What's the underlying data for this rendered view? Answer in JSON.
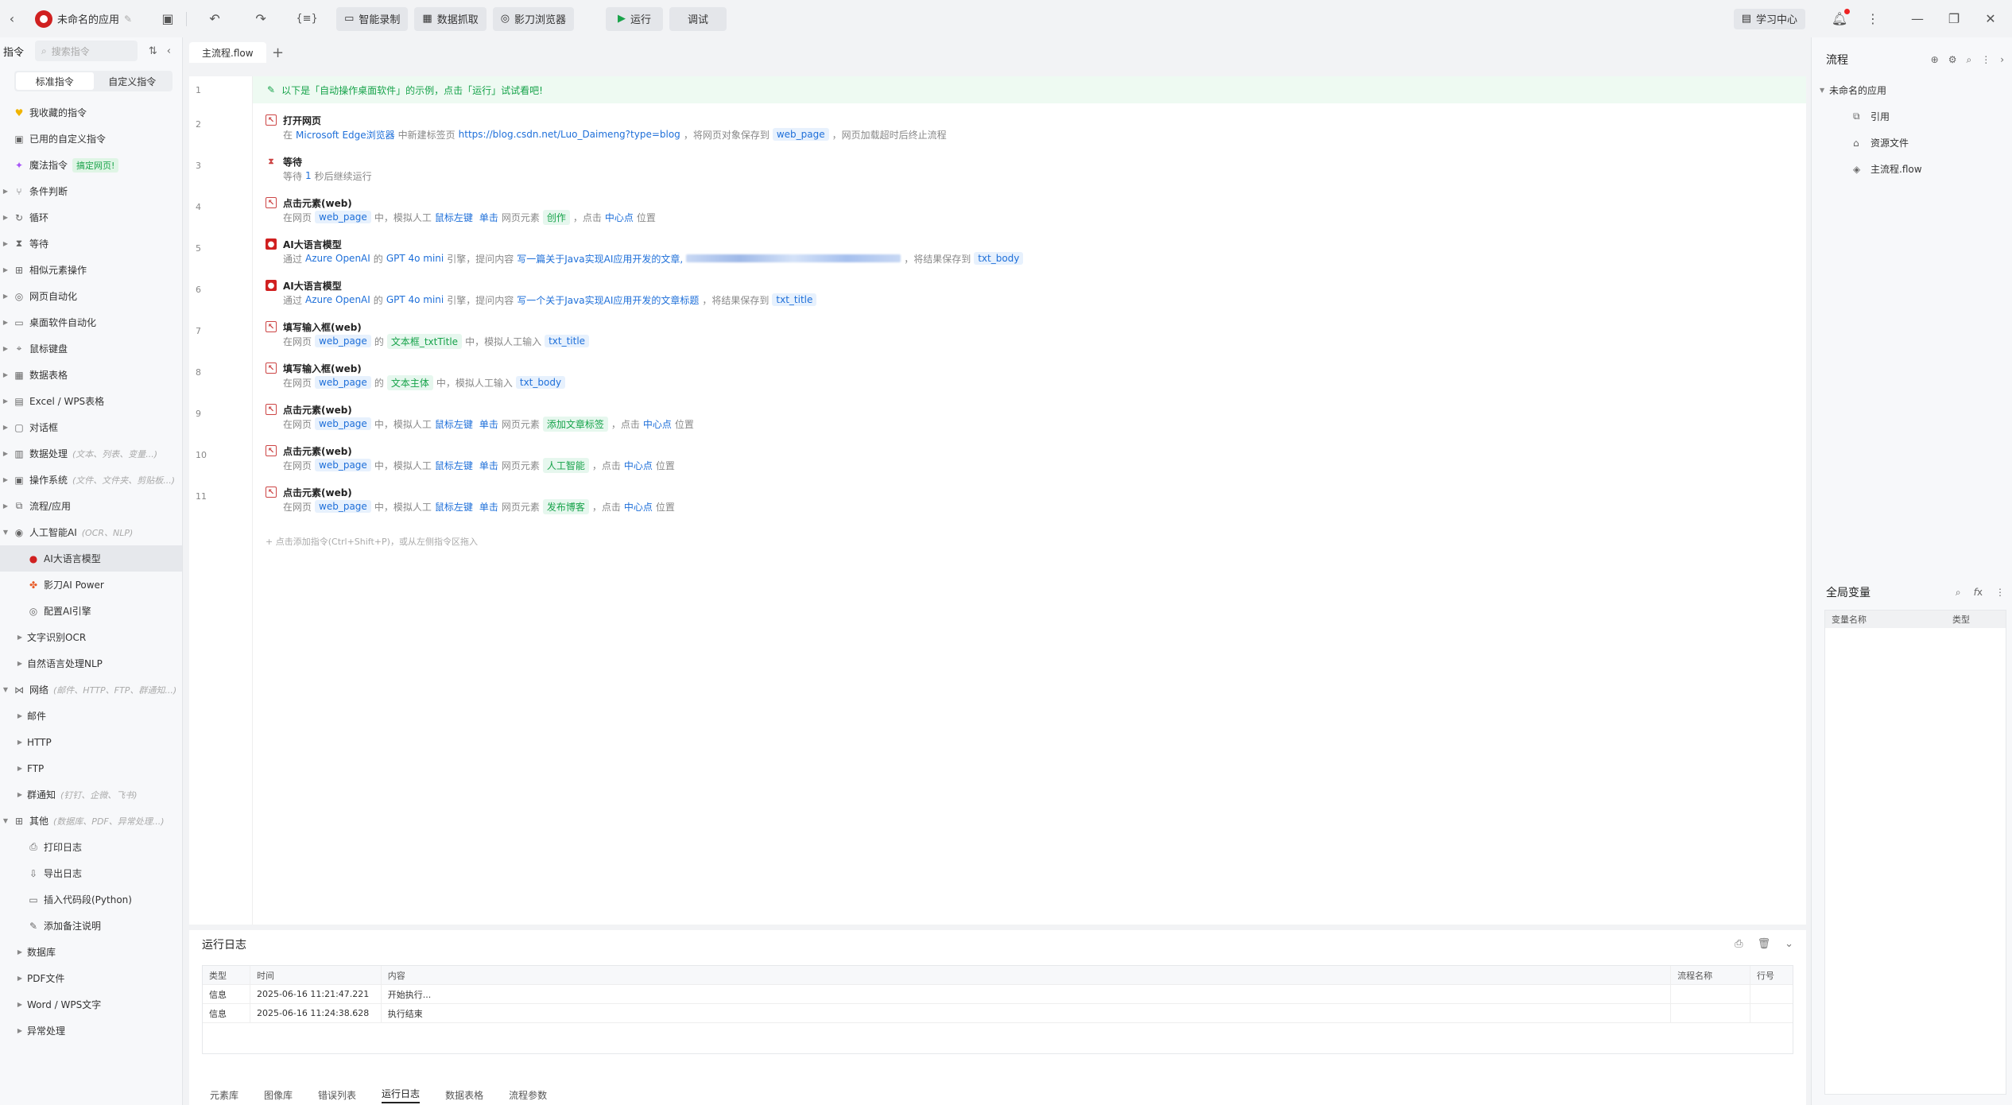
{
  "topbar": {
    "app_name": "未命名的应用",
    "btn_record": "智能录制",
    "btn_capture": "数据抓取",
    "btn_browser": "影刀浏览器",
    "btn_run": "运行",
    "btn_debug": "调试",
    "btn_learn": "学习中心"
  },
  "left": {
    "title": "指令",
    "search_placeholder": "搜索指令",
    "tab_standard": "标准指令",
    "tab_custom": "自定义指令",
    "items": [
      {
        "label": "我收藏的指令",
        "hint": "",
        "icon": "heart-icon"
      },
      {
        "label": "已用的自定义指令",
        "hint": "",
        "icon": "box-icon"
      },
      {
        "label": "魔法指令",
        "hint": "",
        "badge": "搞定网页!",
        "icon": "sparkle-icon"
      },
      {
        "label": "条件判断",
        "hint": "",
        "icon": "branch-icon"
      },
      {
        "label": "循环",
        "hint": "",
        "icon": "loop-icon"
      },
      {
        "label": "等待",
        "hint": "",
        "icon": "hourglass-icon"
      },
      {
        "label": "相似元素操作",
        "hint": "",
        "icon": "grid-icon"
      },
      {
        "label": "网页自动化",
        "hint": "",
        "icon": "globe-icon"
      },
      {
        "label": "桌面软件自动化",
        "hint": "",
        "icon": "monitor-icon"
      },
      {
        "label": "鼠标键盘",
        "hint": "",
        "icon": "mouse-icon"
      },
      {
        "label": "数据表格",
        "hint": "",
        "icon": "table-icon"
      },
      {
        "label": "Excel / WPS表格",
        "hint": "",
        "icon": "excel-icon"
      },
      {
        "label": "对话框",
        "hint": "",
        "icon": "dialog-icon"
      },
      {
        "label": "数据处理",
        "hint": "(文本、列表、变量...)",
        "icon": "data-icon"
      },
      {
        "label": "操作系统",
        "hint": "(文件、文件夹、剪贴板...)",
        "icon": "os-icon"
      },
      {
        "label": "流程/应用",
        "hint": "",
        "icon": "flow-icon"
      },
      {
        "label": "人工智能AI",
        "hint": "(OCR、NLP)",
        "icon": "ai-icon"
      },
      {
        "label": "AI大语言模型",
        "hint": "",
        "icon": "llm-icon",
        "sub": true
      },
      {
        "label": "影刀AI Power",
        "hint": "",
        "icon": "power-icon",
        "sub": true
      },
      {
        "label": "配置AI引擎",
        "hint": "",
        "icon": "engine-icon",
        "sub": true
      },
      {
        "label": "文字识别OCR",
        "hint": "",
        "icon": "",
        "sub": true
      },
      {
        "label": "自然语言处理NLP",
        "hint": "",
        "icon": "",
        "sub": true
      },
      {
        "label": "网络",
        "hint": "(邮件、HTTP、FTP、群通知...)",
        "icon": "network-icon"
      },
      {
        "label": "邮件",
        "hint": "",
        "icon": "",
        "sub": true
      },
      {
        "label": "HTTP",
        "hint": "",
        "icon": "",
        "sub": true
      },
      {
        "label": "FTP",
        "hint": "",
        "icon": "",
        "sub": true
      },
      {
        "label": "群通知",
        "hint": "(钉钉、企微、飞书)",
        "icon": "",
        "sub": true
      },
      {
        "label": "其他",
        "hint": "(数据库、PDF、异常处理...)",
        "icon": "other-icon"
      },
      {
        "label": "打印日志",
        "hint": "",
        "icon": "print-icon",
        "sub": true
      },
      {
        "label": "导出日志",
        "hint": "",
        "icon": "export-icon",
        "sub": true
      },
      {
        "label": "插入代码段(Python)",
        "hint": "",
        "icon": "code-icon",
        "sub": true
      },
      {
        "label": "添加备注说明",
        "hint": "",
        "icon": "note-icon",
        "sub": true
      },
      {
        "label": "数据库",
        "hint": "",
        "icon": "",
        "sub": true
      },
      {
        "label": "PDF文件",
        "hint": "",
        "icon": "",
        "sub": true
      },
      {
        "label": "Word / WPS文字",
        "hint": "",
        "icon": "",
        "sub": true
      },
      {
        "label": "异常处理",
        "hint": "",
        "icon": "",
        "sub": true
      }
    ]
  },
  "editor": {
    "tab": "主流程.flow",
    "banner": "以下是「自动操作桌面软件」的示例，点击「运行」试试看吧!",
    "add_hint": "点击添加指令(Ctrl+Shift+P)，或从左侧指令区拖入",
    "steps": [
      {
        "n": "2",
        "title": "打开网页",
        "icon": "web",
        "desc": [
          [
            "t",
            "在 "
          ],
          [
            "k",
            "Microsoft Edge浏览器"
          ],
          [
            "t",
            " 中新建标签页 "
          ],
          [
            "k",
            "https://blog.csdn.net/Luo_Daimeng?type=blog"
          ],
          [
            "t",
            "，将网页对象保存到 "
          ],
          [
            "v",
            "web_page"
          ],
          [
            "t",
            "，网页加载超时后终止流程"
          ]
        ]
      },
      {
        "n": "3",
        "title": "等待",
        "icon": "wait",
        "desc": [
          [
            "t",
            "等待 "
          ],
          [
            "k",
            "1"
          ],
          [
            "t",
            " 秒后继续运行"
          ]
        ]
      },
      {
        "n": "4",
        "title": "点击元素(web)",
        "icon": "web",
        "desc": [
          [
            "t",
            "在网页 "
          ],
          [
            "v",
            "web_page"
          ],
          [
            "t",
            " 中，模拟人工 "
          ],
          [
            "k",
            "鼠标左键"
          ],
          [
            "t",
            " "
          ],
          [
            "k",
            "单击"
          ],
          [
            "t",
            " 网页元素 "
          ],
          [
            "e",
            "创作"
          ],
          [
            "t",
            " ，点击 "
          ],
          [
            "k",
            "中心点"
          ],
          [
            "t",
            " 位置"
          ]
        ]
      },
      {
        "n": "5",
        "title": "AI大语言模型",
        "icon": "ai",
        "desc": [
          [
            "t",
            "通过 "
          ],
          [
            "k",
            "Azure OpenAI"
          ],
          [
            "t",
            " 的 "
          ],
          [
            "k",
            "GPT 4o mini"
          ],
          [
            "t",
            " 引擎，提问内容 "
          ],
          [
            "k",
            "写一篇关于Java实现AI应用开发的文章,"
          ],
          [
            "b",
            ""
          ],
          [
            "t",
            "，将结果保存到 "
          ],
          [
            "v",
            "txt_body"
          ]
        ]
      },
      {
        "n": "6",
        "title": "AI大语言模型",
        "icon": "ai",
        "desc": [
          [
            "t",
            "通过 "
          ],
          [
            "k",
            "Azure OpenAI"
          ],
          [
            "t",
            " 的 "
          ],
          [
            "k",
            "GPT 4o mini"
          ],
          [
            "t",
            " 引擎，提问内容 "
          ],
          [
            "k",
            "写一个关于Java实现AI应用开发的文章标题"
          ],
          [
            "t",
            "，将结果保存到 "
          ],
          [
            "v",
            "txt_title"
          ]
        ]
      },
      {
        "n": "7",
        "title": "填写输入框(web)",
        "icon": "web",
        "desc": [
          [
            "t",
            "在网页 "
          ],
          [
            "v",
            "web_page"
          ],
          [
            "t",
            " 的 "
          ],
          [
            "e",
            "文本框_txtTitle"
          ],
          [
            "t",
            " 中，模拟人工输入 "
          ],
          [
            "v",
            "txt_title"
          ]
        ]
      },
      {
        "n": "8",
        "title": "填写输入框(web)",
        "icon": "web",
        "desc": [
          [
            "t",
            "在网页 "
          ],
          [
            "v",
            "web_page"
          ],
          [
            "t",
            " 的 "
          ],
          [
            "e",
            "文本主体"
          ],
          [
            "t",
            " 中，模拟人工输入 "
          ],
          [
            "v",
            "txt_body"
          ]
        ]
      },
      {
        "n": "9",
        "title": "点击元素(web)",
        "icon": "web",
        "desc": [
          [
            "t",
            "在网页 "
          ],
          [
            "v",
            "web_page"
          ],
          [
            "t",
            " 中，模拟人工 "
          ],
          [
            "k",
            "鼠标左键"
          ],
          [
            "t",
            " "
          ],
          [
            "k",
            "单击"
          ],
          [
            "t",
            " 网页元素 "
          ],
          [
            "e",
            "添加文章标签"
          ],
          [
            "t",
            " ，点击 "
          ],
          [
            "k",
            "中心点"
          ],
          [
            "t",
            " 位置"
          ]
        ]
      },
      {
        "n": "10",
        "title": "点击元素(web)",
        "icon": "web",
        "desc": [
          [
            "t",
            "在网页 "
          ],
          [
            "v",
            "web_page"
          ],
          [
            "t",
            " 中，模拟人工 "
          ],
          [
            "k",
            "鼠标左键"
          ],
          [
            "t",
            " "
          ],
          [
            "k",
            "单击"
          ],
          [
            "t",
            " 网页元素 "
          ],
          [
            "e",
            "人工智能"
          ],
          [
            "t",
            " ，点击 "
          ],
          [
            "k",
            "中心点"
          ],
          [
            "t",
            " 位置"
          ]
        ]
      },
      {
        "n": "11",
        "title": "点击元素(web)",
        "icon": "web",
        "desc": [
          [
            "t",
            "在网页 "
          ],
          [
            "v",
            "web_page"
          ],
          [
            "t",
            " 中，模拟人工 "
          ],
          [
            "k",
            "鼠标左键"
          ],
          [
            "t",
            " "
          ],
          [
            "k",
            "单击"
          ],
          [
            "t",
            " 网页元素 "
          ],
          [
            "e",
            "发布博客"
          ],
          [
            "t",
            " ，点击 "
          ],
          [
            "k",
            "中心点"
          ],
          [
            "t",
            " 位置"
          ]
        ]
      }
    ]
  },
  "log": {
    "title": "运行日志",
    "columns": [
      "类型",
      "时间",
      "内容",
      "流程名称",
      "行号"
    ],
    "rows": [
      [
        "信息",
        "2025-06-16 11:21:47.221",
        "开始执行...",
        "",
        ""
      ],
      [
        "信息",
        "2025-06-16 11:24:38.628",
        "执行结束",
        "",
        ""
      ]
    ],
    "tabs": [
      "元素库",
      "图像库",
      "错误列表",
      "运行日志",
      "数据表格",
      "流程参数"
    ],
    "active_tab": "运行日志"
  },
  "right": {
    "title": "流程",
    "root": "未命名的应用",
    "items": [
      "引用",
      "资源文件",
      "主流程.flow"
    ],
    "gv_title": "全局变量",
    "gv_cols": [
      "变量名称",
      "类型"
    ]
  }
}
